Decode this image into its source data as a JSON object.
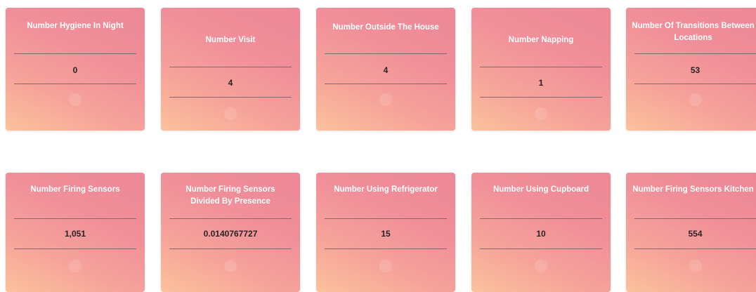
{
  "cards": [
    {
      "title": "Number Hygiene In Night",
      "value": "0"
    },
    {
      "title": "Number Visit",
      "value": "4"
    },
    {
      "title": "Number Outside The House",
      "value": "4"
    },
    {
      "title": "Number Napping",
      "value": "1"
    },
    {
      "title": "Number Of Transitions Between Locations",
      "value": "53"
    },
    {
      "title": "Number Firing Sensors",
      "value": "1,051"
    },
    {
      "title": "Number Firing Sensors Divided By Presence",
      "value": "0.0140767727"
    },
    {
      "title": "Number Using Refrigerator",
      "value": "15"
    },
    {
      "title": "Number Using Cupboard",
      "value": "10"
    },
    {
      "title": "Number Firing Sensors Kitchen",
      "value": "554"
    }
  ]
}
